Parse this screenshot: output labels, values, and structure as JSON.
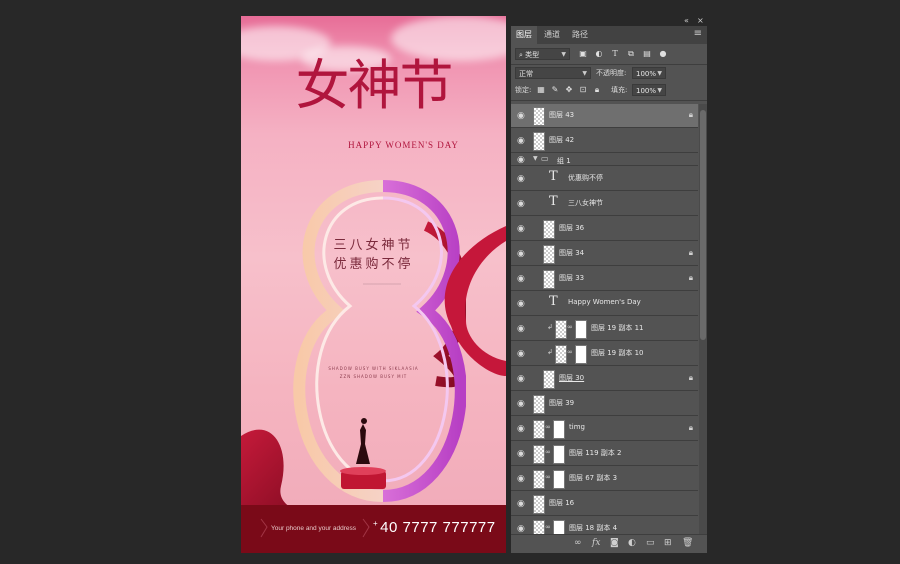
{
  "poster": {
    "title_cn": "女神节",
    "title_en": "HAPPY WOMEN'S DAY",
    "slogan_1": "三八女神节",
    "slogan_2": "优惠购不停",
    "tiny_1": "SHADOW BUSY WITH SIKLAASIA",
    "tiny_2": "ZZN SHADOW BUSY MIT",
    "footer_addr": "Your phone and your address",
    "footer_plus": "+",
    "footer_phone": "40 7777 777777"
  },
  "panel": {
    "collapse_icon": "«",
    "close_icon": "×",
    "tabs": [
      "图层",
      "通道",
      "路径"
    ],
    "menu_icon": "≡",
    "filter_label": "类型",
    "blend_mode": "正常",
    "opacity_label": "不透明度:",
    "opacity_value": "100%",
    "lock_label": "锁定:",
    "fill_label": "填充:",
    "fill_value": "100%"
  },
  "layers": [
    {
      "name": "图层 43",
      "type": "pixel",
      "locked": true,
      "selected": true
    },
    {
      "name": "图层 42",
      "type": "pixel",
      "locked": false
    },
    {
      "name": "组 1",
      "type": "group",
      "locked": false
    },
    {
      "name": "优惠购不停",
      "type": "text",
      "locked": false
    },
    {
      "name": "三八女神节",
      "type": "text",
      "locked": false
    },
    {
      "name": "图层 36",
      "type": "pixel",
      "locked": false
    },
    {
      "name": "图层 34",
      "type": "pixel",
      "locked": true
    },
    {
      "name": "图层 33",
      "type": "pixel",
      "locked": true
    },
    {
      "name": "Happy Women's Day",
      "type": "text",
      "locked": false
    },
    {
      "name": "图层 19 副本 11",
      "type": "masked",
      "locked": false
    },
    {
      "name": "图层 19 副本 10",
      "type": "masked",
      "locked": false
    },
    {
      "name": "图层 30",
      "type": "pixel",
      "locked": true
    },
    {
      "name": "图层 39",
      "type": "pixel",
      "locked": false
    },
    {
      "name": "timg",
      "type": "masked-top",
      "locked": true
    },
    {
      "name": "图层 119 副本 2",
      "type": "masked-top",
      "locked": false
    },
    {
      "name": "图层 67 副本 3",
      "type": "masked-top",
      "locked": false
    },
    {
      "name": "图层 16",
      "type": "pixel",
      "locked": false
    },
    {
      "name": "图层 18 副本 4",
      "type": "masked-top",
      "locked": false
    }
  ],
  "bottom_icons": [
    "link-icon",
    "fx-icon",
    "mask-icon",
    "adjustment-icon",
    "folder-icon",
    "new-layer-icon",
    "trash-icon"
  ],
  "colors": {
    "panel_bg": "#535353",
    "app_bg": "#282828",
    "poster_red": "#b0153d",
    "footer_red": "#7a0a18"
  }
}
